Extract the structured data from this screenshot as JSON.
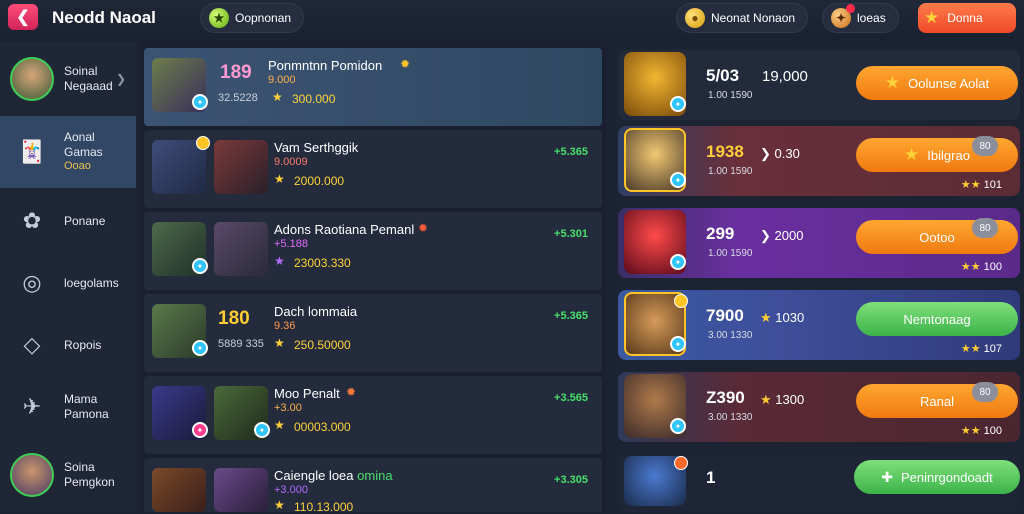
{
  "header": {
    "title": "Neodd Naoal",
    "search_label": "Oopnonan",
    "currency1_label": "Neonat Nonaon",
    "currency2_label": "loeas",
    "cta_label": "Donna",
    "back_icon": "back-arrow-icon"
  },
  "sidebar": {
    "items": [
      {
        "label": "Soinal",
        "sub": "Negaaad"
      },
      {
        "label": "Aonal",
        "label2": "Gamas",
        "sub": "Ooao"
      },
      {
        "label": "Ponane"
      },
      {
        "label": "loegolams"
      },
      {
        "label": "Ropois"
      },
      {
        "label": "Mama",
        "sub": "Pamona"
      },
      {
        "label": "Soina",
        "sub": "Pemgkon"
      }
    ]
  },
  "list": {
    "rows": [
      {
        "rank": "189",
        "title": "Ponmntnn Pomidon",
        "sub": "9.000",
        "gray": "32.5228",
        "pts": "300.000"
      },
      {
        "title": "Vam Serthggik",
        "sub": "9.0009",
        "pts": "2000.000",
        "change": "+5.365"
      },
      {
        "title": "Adons Raotiana Pemanl",
        "sub": "+5.188",
        "pts": "23003.330",
        "change": "+5.301"
      },
      {
        "rank": "180",
        "title": "Dach lommaia",
        "sub": "9.36",
        "gray": "5889 335",
        "pts": "250.50000",
        "change": "+5.365"
      },
      {
        "title": "Moo Penalt",
        "sub": "+3.00",
        "pts": "00003.000",
        "change": "+3.565"
      },
      {
        "title": "Caiengle loea",
        "title_tag": "omina",
        "sub": "+3.000",
        "pts": "110.13.000",
        "change": "+3.305"
      }
    ]
  },
  "cards": [
    {
      "big": "5/03",
      "mid": "19,000",
      "small": "1.00 1590",
      "button": "Oolunse Aolat",
      "btn_style": "orange"
    },
    {
      "big": "1938",
      "mid": "0.30",
      "small": "1.00 1590",
      "button": "Ibilgrao",
      "btn_style": "orange",
      "lock": "80",
      "stars": "101"
    },
    {
      "big": "299",
      "mid": "2000",
      "small": "1.00 1590",
      "button": "Ootoo",
      "btn_style": "orange",
      "lock": "80",
      "stars": "100"
    },
    {
      "big": "7900",
      "mid": "1030",
      "small": "3.00 1330",
      "button": "Nemtonaag",
      "btn_style": "green",
      "stars": "107"
    },
    {
      "big": "Z390",
      "mid": "1300",
      "small": "3.00 1330",
      "button": "Ranal",
      "btn_style": "orange",
      "lock": "80",
      "stars": "100"
    },
    {
      "big": "1",
      "button": "Peninrgondoadt",
      "btn_style": "green"
    }
  ]
}
